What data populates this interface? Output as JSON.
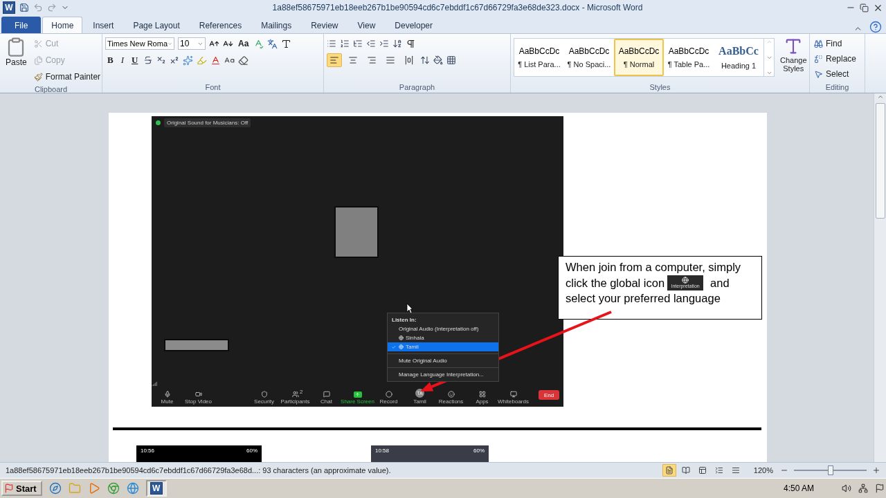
{
  "window": {
    "logo": "W",
    "title": "1a88ef58675971eb18eeb267b1be90594cd6c7ebddf1c67d66729fa3e68de323.docx - Microsoft Word"
  },
  "tabs": [
    {
      "label": "File",
      "kind": "file",
      "selected": false
    },
    {
      "label": "Home",
      "kind": "tab",
      "selected": true
    },
    {
      "label": "Insert",
      "kind": "tab",
      "selected": false
    },
    {
      "label": "Page Layout",
      "kind": "tab",
      "selected": false
    },
    {
      "label": "References",
      "kind": "tab",
      "selected": false
    },
    {
      "label": "Mailings",
      "kind": "tab",
      "selected": false
    },
    {
      "label": "Review",
      "kind": "tab",
      "selected": false
    },
    {
      "label": "View",
      "kind": "tab",
      "selected": false
    },
    {
      "label": "Developer",
      "kind": "tab",
      "selected": false
    }
  ],
  "clipboard": {
    "paste": "Paste",
    "label": "Clipboard",
    "actions": [
      {
        "label": "Cut",
        "disabled": true
      },
      {
        "label": "Copy",
        "disabled": true
      },
      {
        "label": "Format Painter",
        "disabled": false
      }
    ]
  },
  "font": {
    "name": "Times New Roma",
    "size": "10",
    "case_button": "Aa",
    "format_buttons": [
      "B",
      "I",
      "U"
    ],
    "label": "Font"
  },
  "paragraph": {
    "label": "Paragraph",
    "alignments": [
      {
        "selected": true
      },
      {
        "selected": false
      },
      {
        "selected": false
      },
      {
        "selected": false
      },
      {
        "selected": false
      }
    ]
  },
  "styles": {
    "label": "Styles",
    "change_styles": "Change Styles",
    "items": [
      {
        "preview": "AaBbCcDc",
        "name": "¶ List Para...",
        "kind": "plain",
        "selected": false
      },
      {
        "preview": "AaBbCcDc",
        "name": "¶ No Spaci...",
        "kind": "plain",
        "selected": false
      },
      {
        "preview": "AaBbCcDc",
        "name": "¶ Normal",
        "kind": "plain",
        "selected": true
      },
      {
        "preview": "AaBbCcDc",
        "name": "¶ Table Pa...",
        "kind": "plain",
        "selected": false
      },
      {
        "preview": "AaBbCc",
        "name": "Heading 1",
        "kind": "heading",
        "selected": false
      }
    ]
  },
  "editing": {
    "label": "Editing",
    "items": [
      "Find",
      "Replace",
      "Select"
    ]
  },
  "document": {
    "meeting_screenshot": {
      "badge": "Original Sound for Musicians: Off",
      "menu": {
        "title": "Listen In:",
        "items": [
          {
            "label": "Original Audio (Interpretation off)",
            "kind": "plain",
            "selected": false
          },
          {
            "label": "Sinhala",
            "kind": "language",
            "selected": false
          },
          {
            "label": "Tamil",
            "kind": "language",
            "selected": true
          },
          {
            "label": "Mute Original Audio",
            "kind": "plain",
            "selected": false
          },
          {
            "label": "Manage Language Interpretation...",
            "kind": "plain",
            "selected": false
          }
        ]
      },
      "toolbar": [
        {
          "label": "Mute",
          "highlighted": false
        },
        {
          "label": "Stop Video",
          "highlighted": false
        },
        {
          "label": "Security",
          "highlighted": false
        },
        {
          "label": "Participants",
          "count": "2",
          "highlighted": false
        },
        {
          "label": "Chat",
          "highlighted": false
        },
        {
          "label": "Share Screen",
          "highlighted": true
        },
        {
          "label": "Record",
          "highlighted": false
        },
        {
          "label": "Tamil",
          "avatar": "TA",
          "highlighted": false
        },
        {
          "label": "Reactions",
          "highlighted": false
        },
        {
          "label": "Apps",
          "highlighted": false
        },
        {
          "label": "Whiteboards",
          "highlighted": false
        }
      ],
      "end_button": "End"
    },
    "callout": {
      "line_1": "When join from a computer, simply",
      "line_2_before": "click the global icon",
      "icon_caption": "Interpretation",
      "line_2_after": "and",
      "line_3": "select your preferred language"
    },
    "phones": [
      {
        "time": "10:56",
        "battery": "60%",
        "kind": "dark"
      },
      {
        "time": "10:58",
        "battery": "60%",
        "kind": "slate"
      }
    ]
  },
  "status_bar": {
    "text": "1a88ef58675971eb18eeb267b1be90594cd6c7ebddf1c67d66729fa3e68d...: 93 characters (an approximate value).",
    "views": [
      {
        "selected": true
      },
      {
        "selected": false
      },
      {
        "selected": false
      },
      {
        "selected": false
      },
      {
        "selected": false
      }
    ],
    "zoom": "120%",
    "zoom_slider": {
      "level": 0.5
    }
  },
  "taskbar": {
    "start": "Start",
    "word_logo": "W",
    "clock": "4:50 AM"
  }
}
